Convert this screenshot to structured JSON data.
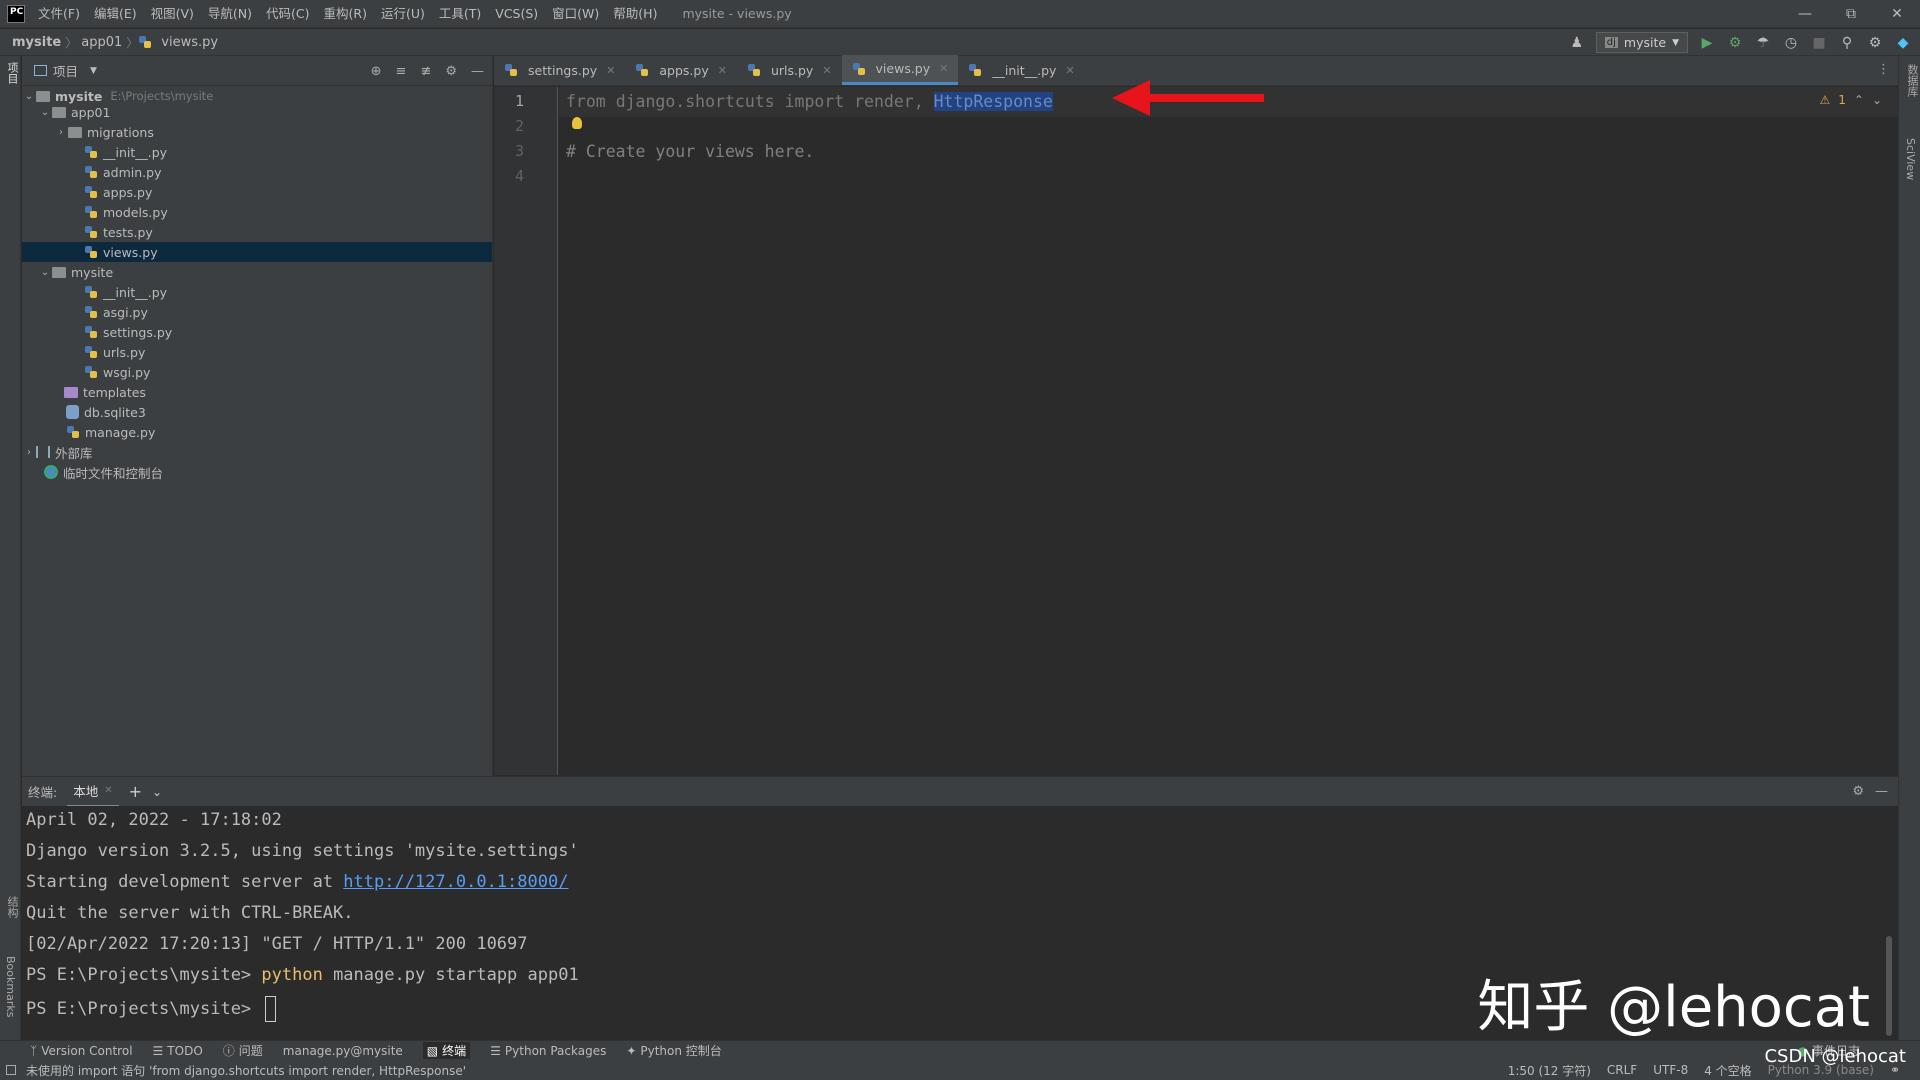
{
  "titlebar": {
    "logo": "PC",
    "menus": [
      "文件(F)",
      "编辑(E)",
      "视图(V)",
      "导航(N)",
      "代码(C)",
      "重构(R)",
      "运行(U)",
      "工具(T)",
      "VCS(S)",
      "窗口(W)",
      "帮助(H)"
    ],
    "title": "mysite - views.py"
  },
  "navbar": {
    "crumbs": [
      "mysite",
      "app01",
      "views.py"
    ],
    "run_config": "mysite"
  },
  "left_stripe": {
    "project": "项目",
    "structure": "结构",
    "bookmarks": "Bookmarks"
  },
  "right_stripe": {
    "database": "数据库",
    "sciview": "SciView"
  },
  "project_panel": {
    "title": "项目",
    "root_name": "mysite",
    "root_path": "E:\\Projects\\mysite",
    "items": [
      {
        "label": "app01"
      },
      {
        "label": "migrations"
      },
      {
        "label": "__init__.py"
      },
      {
        "label": "admin.py"
      },
      {
        "label": "apps.py"
      },
      {
        "label": "models.py"
      },
      {
        "label": "tests.py"
      },
      {
        "label": "views.py"
      },
      {
        "label": "mysite"
      },
      {
        "label": "__init__.py"
      },
      {
        "label": "asgi.py"
      },
      {
        "label": "settings.py"
      },
      {
        "label": "urls.py"
      },
      {
        "label": "wsgi.py"
      },
      {
        "label": "templates"
      },
      {
        "label": "db.sqlite3"
      },
      {
        "label": "manage.py"
      },
      {
        "label": "外部库"
      },
      {
        "label": "临时文件和控制台"
      }
    ]
  },
  "editor": {
    "tabs": [
      "settings.py",
      "apps.py",
      "urls.py",
      "views.py",
      "__init__.py"
    ],
    "active_tab": "views.py",
    "line_numbers": [
      "1",
      "2",
      "3",
      "4"
    ],
    "line1_kw_from": "from",
    "line1_module": "django.shortcuts",
    "line1_kw_import": "import",
    "line1_render": "render,",
    "line1_selected": "HttpResponse",
    "line3_comment": "# Create your views here.",
    "warning_count": "1"
  },
  "terminal": {
    "label": "终端:",
    "tab": "本地",
    "lines": [
      "April 02, 2022 - 17:18:02",
      "Django version 3.2.5, using settings 'mysite.settings'",
      "Starting development server at ",
      "Quit the server with CTRL-BREAK.",
      "[02/Apr/2022 17:20:13] \"GET / HTTP/1.1\" 200 10697",
      "PS E:\\Projects\\mysite> ",
      "PS E:\\Projects\\mysite> "
    ],
    "server_link": "http://127.0.0.1:8000/",
    "cmd_python": "python",
    "cmd_rest": " manage.py startapp app01"
  },
  "watermark": "知乎 @lehocat",
  "tool_windows": [
    "Version Control",
    "TODO",
    "问题",
    "manage.py@mysite",
    "终端",
    "Python Packages",
    "Python 控制台"
  ],
  "event_log": "事件日志",
  "statusbar": {
    "message": "未使用的 import 语句 'from django.shortcuts import render, HttpResponse'",
    "position": "1:50 (12 字符)",
    "line_sep": "CRLF",
    "encoding": "UTF-8",
    "indent": "4 个空格",
    "interpreter": "Python 3.9 (base)"
  },
  "csdn": "CSDN @lehocat",
  "colors": {
    "accent": "#4a88c7",
    "selection": "#214283",
    "arrow": "#e8141c"
  }
}
